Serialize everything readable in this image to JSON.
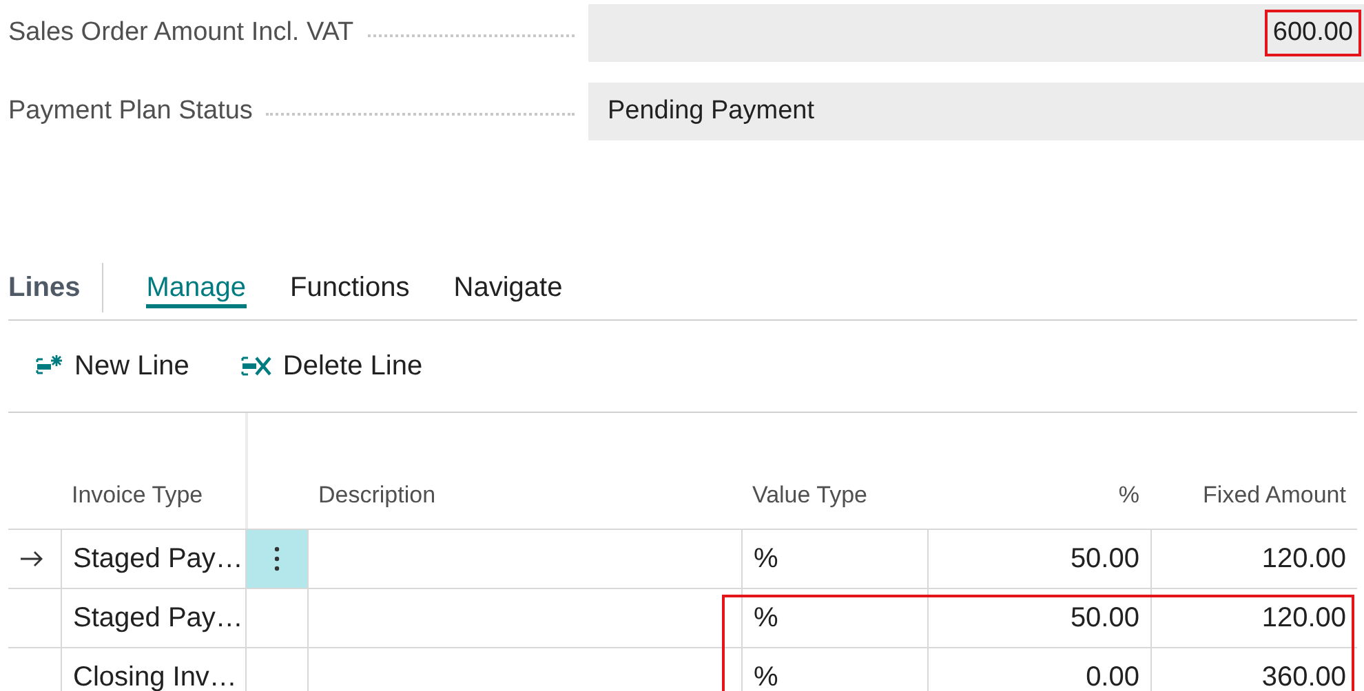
{
  "fields": [
    {
      "label": "Sales Order Amount Incl. VAT",
      "value": "600.00",
      "kind": "amount",
      "highlighted": true
    },
    {
      "label": "Payment Plan Status",
      "value": "Pending Payment",
      "kind": "status",
      "highlighted": false
    }
  ],
  "lines": {
    "title": "Lines",
    "tabs": [
      {
        "label": "Manage",
        "selected": true
      },
      {
        "label": "Functions",
        "selected": false
      },
      {
        "label": "Navigate",
        "selected": false
      }
    ],
    "actions": [
      {
        "label": "New Line",
        "kind": "new"
      },
      {
        "label": "Delete Line",
        "kind": "delete"
      }
    ],
    "columns": [
      "Invoice Type",
      "Description",
      "Value Type",
      "%",
      "Fixed Amount"
    ],
    "rows": [
      {
        "current": true,
        "highlighted": false,
        "cells": [
          "Staged Pay…",
          "",
          "%",
          "50.00",
          "120.00"
        ]
      },
      {
        "current": false,
        "highlighted": true,
        "cells": [
          "Staged Pay…",
          "",
          "%",
          "50.00",
          "120.00"
        ]
      },
      {
        "current": false,
        "highlighted": true,
        "cells": [
          "Closing Inv…",
          "",
          "%",
          "0.00",
          "360.00"
        ]
      }
    ]
  }
}
